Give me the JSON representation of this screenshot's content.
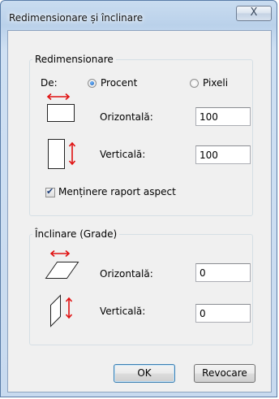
{
  "window": {
    "title": "Redimensionare și înclinare",
    "close_label": "X"
  },
  "resize": {
    "legend": "Redimensionare",
    "by_label": "De:",
    "percent_label": "Procent",
    "pixels_label": "Pixeli",
    "selected_unit": "Procent",
    "horizontal_label": "Orizontală:",
    "horizontal_value": "100",
    "vertical_label": "Verticală:",
    "vertical_value": "100",
    "keep_aspect_label": "Menținere raport aspect",
    "keep_aspect_checked": true
  },
  "skew": {
    "legend": "Înclinare (Grade)",
    "horizontal_label": "Orizontală:",
    "horizontal_value": "0",
    "vertical_label": "Verticală:",
    "vertical_value": "0"
  },
  "buttons": {
    "ok_label": "OK",
    "cancel_label": "Revocare"
  },
  "icons": {
    "resize_horizontal": "resize-horizontal-icon",
    "resize_vertical": "resize-vertical-icon",
    "skew_horizontal": "skew-horizontal-icon",
    "skew_vertical": "skew-vertical-icon",
    "arrow_color": "#e01010"
  }
}
